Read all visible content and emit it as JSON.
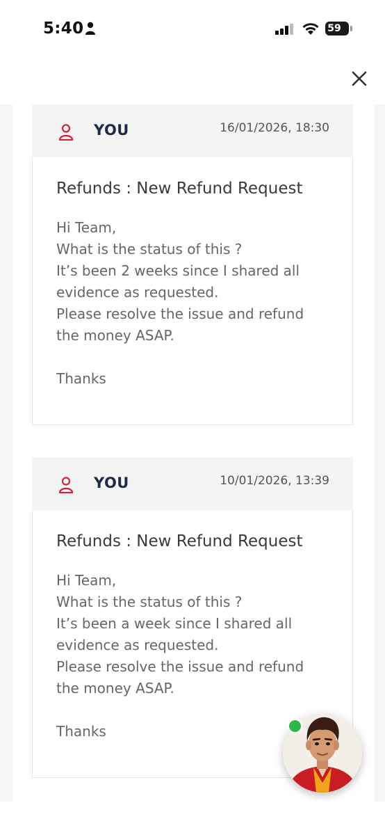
{
  "status_bar": {
    "time": "5:40",
    "battery": "59"
  },
  "messages": [
    {
      "sender": "YOU",
      "date": "16/01/2026, 18:30",
      "subject": "Refunds : New Refund Request",
      "body": "Hi Team,\nWhat is the status of this ?\nIt’s been 2 weeks since I shared all\nevidence as requested.\nPlease resolve the issue and refund\nthe money ASAP.\n\nThanks"
    },
    {
      "sender": "YOU",
      "date": "10/01/2026, 13:39",
      "subject": "Refunds : New Refund Request",
      "body": "Hi Team,\nWhat is the status of this ?\nIt’s been a week since I shared all\nevidence as requested.\nPlease resolve the issue and refund\nthe money ASAP.\n\nThanks"
    }
  ],
  "colors": {
    "user_icon": "#d0243a",
    "sender": "#1e2a4a",
    "online": "#2fb54a"
  },
  "icons": {
    "close": "close-icon",
    "user": "user-icon",
    "assistant": "assistant-avatar"
  }
}
